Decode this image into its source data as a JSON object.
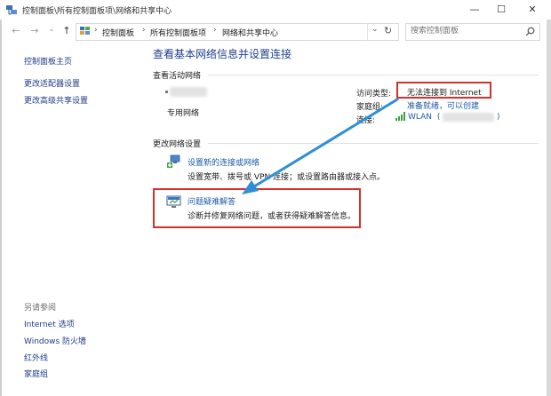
{
  "window": {
    "title": "控制面板\\所有控制面板项\\网络和共享中心",
    "minimize_glyph": "—",
    "maximize_glyph": "☐",
    "close_glyph": "✕"
  },
  "nav": {
    "back_glyph": "←",
    "forward_glyph": "→",
    "dropdown_glyph": "⌄",
    "up_glyph": "↑"
  },
  "address": {
    "crumbs": [
      "控制面板",
      "所有控制面板项",
      "网络和共享中心"
    ],
    "separator": "›",
    "dropdown_glyph": "⌄",
    "refresh_glyph": "↻"
  },
  "search": {
    "placeholder": "搜索控制面板",
    "icon": "search-icon"
  },
  "sidebar": {
    "home": "控制面板主页",
    "links": [
      "更改适配器设置",
      "更改高级共享设置"
    ],
    "see_also_label": "另请参阅",
    "see_also": [
      "Internet 选项",
      "Windows 防火墙",
      "红外线",
      "家庭组"
    ]
  },
  "main": {
    "title": "查看基本网络信息并设置连接",
    "active_networks_label": "查看活动网络",
    "network_type": "专用网络",
    "access_type_label": "访问类型:",
    "access_type_value": "无法连接到 Internet",
    "homegroup_label": "家庭组:",
    "homegroup_value": "准备就绪，可以创建",
    "connections_label": "连接:",
    "connection_value": "WLAN",
    "connection_suffix_open": "(",
    "connection_suffix_close": ")",
    "change_settings_label": "更改网络设置",
    "setup_link": "设置新的连接或网络",
    "setup_desc": "设置宽带、拨号或 VPN 连接；或设置路由器或接入点。",
    "troubleshoot_link": "问题疑难解答",
    "troubleshoot_desc": "诊断并修复网络问题，或者获得疑难解答信息。"
  },
  "colors": {
    "annotation_red": "#d6302b",
    "annotation_arrow": "#2f8fd6",
    "link_blue": "#1e5aa8",
    "title_blue": "#1e3f8f"
  }
}
